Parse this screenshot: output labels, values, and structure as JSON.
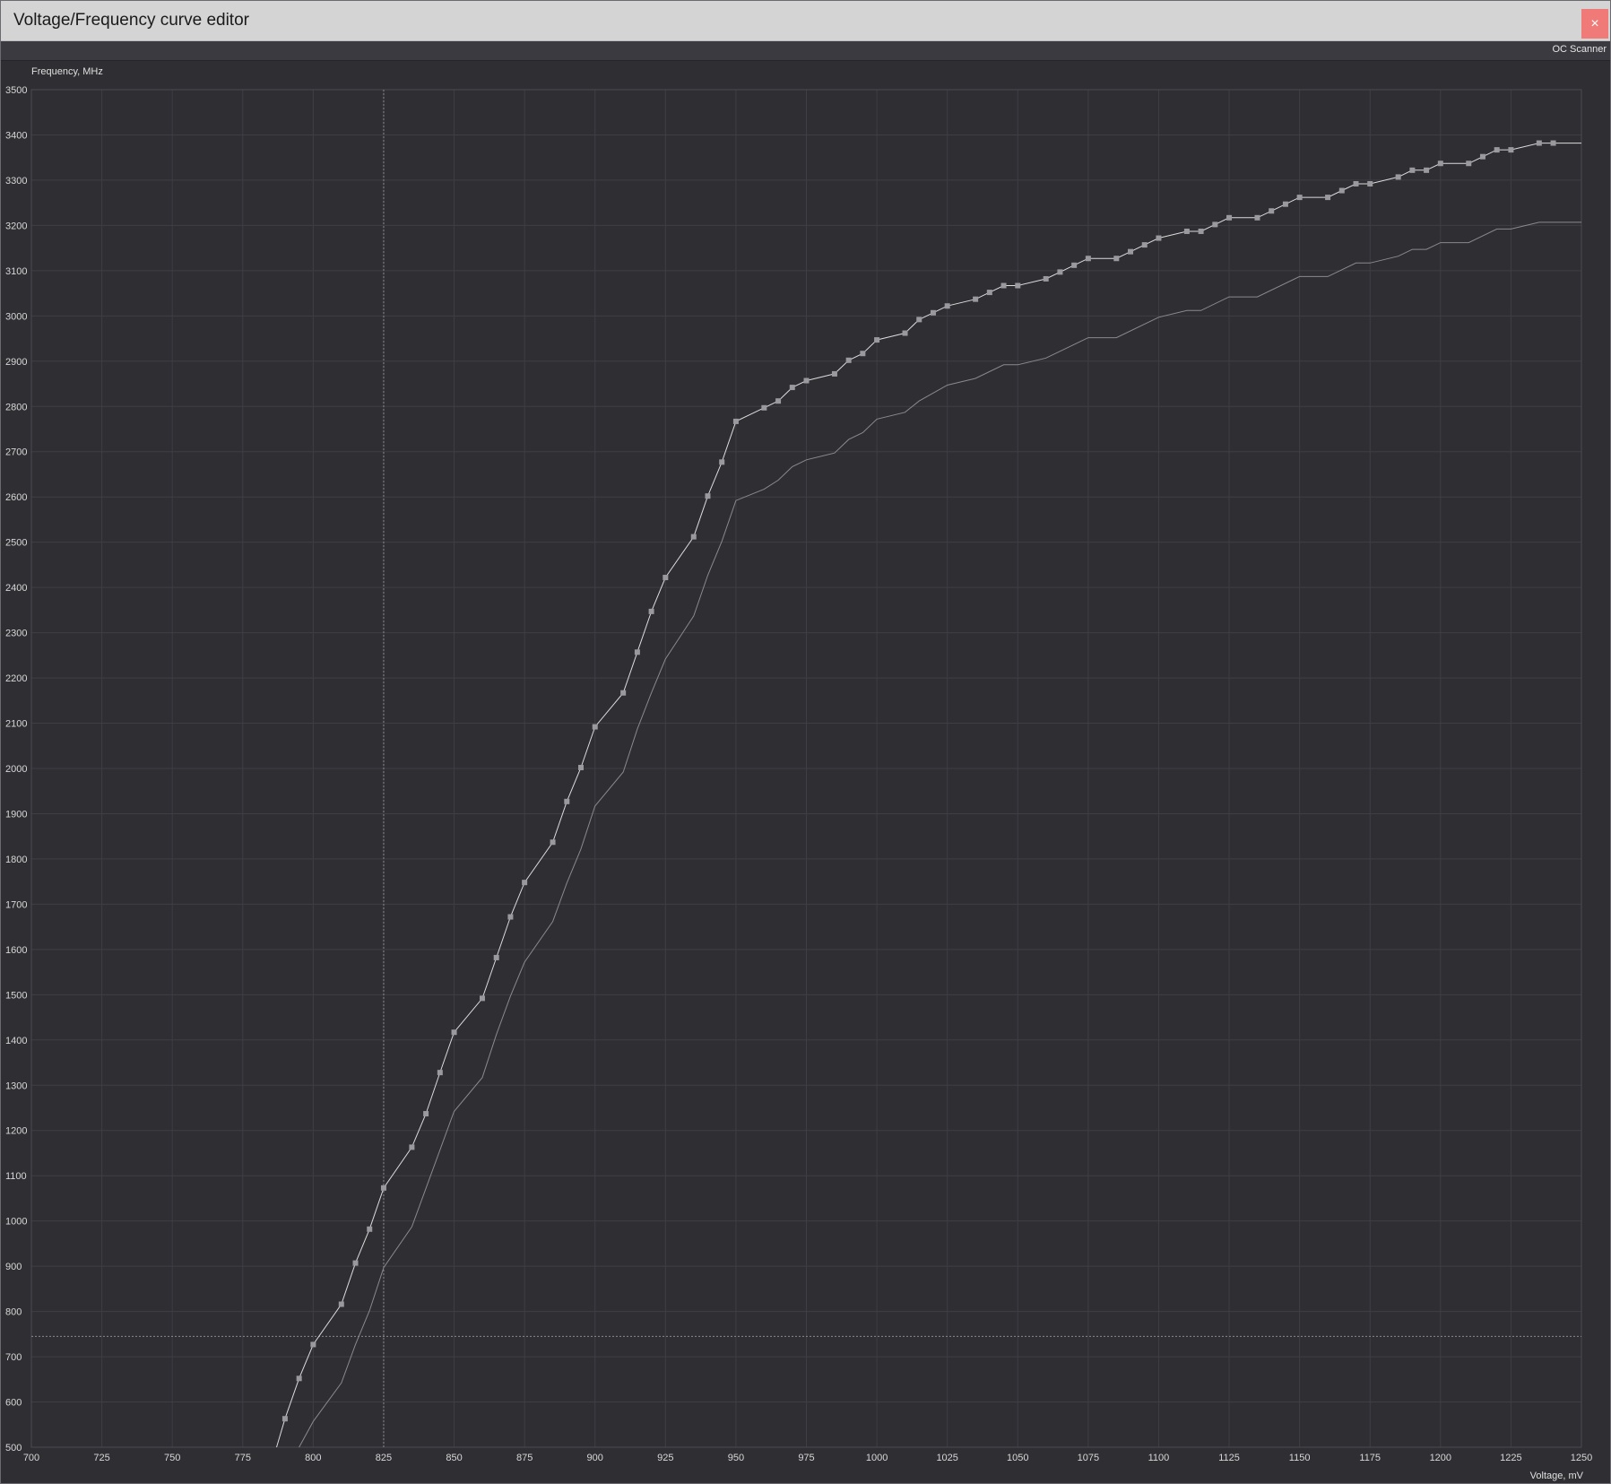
{
  "window": {
    "title": "Voltage/Frequency curve editor",
    "close_label": "×"
  },
  "toolbar": {
    "oc_scanner_label": "OC Scanner"
  },
  "colors": {
    "background": "#2e2e33",
    "grid": "#3e3e44",
    "curve": "#dcdcdc",
    "baseline_curve": "#8a8a8e",
    "point": "#9a9a9e",
    "close_button": "#f07a78"
  },
  "chart_data": {
    "type": "line",
    "xlabel": "Voltage, mV",
    "ylabel": "Frequency, MHz",
    "xlim": [
      700,
      1250
    ],
    "ylim": [
      500,
      3500
    ],
    "x_ticks": [
      700,
      725,
      750,
      775,
      800,
      825,
      850,
      875,
      900,
      925,
      950,
      975,
      1000,
      1025,
      1050,
      1075,
      1100,
      1125,
      1150,
      1175,
      1200,
      1225,
      1250
    ],
    "y_ticks": [
      500,
      600,
      700,
      800,
      900,
      1000,
      1100,
      1200,
      1300,
      1400,
      1500,
      1600,
      1700,
      1800,
      1900,
      2000,
      2100,
      2200,
      2300,
      2400,
      2500,
      2600,
      2700,
      2800,
      2900,
      3000,
      3100,
      3200,
      3300,
      3400,
      3500
    ],
    "grid": true,
    "cursor": {
      "voltage": 825,
      "frequency": 745
    },
    "series": [
      {
        "role": "edited",
        "points": [
          [
            787,
            500
          ],
          [
            790,
            563
          ],
          [
            795,
            652
          ],
          [
            800,
            727
          ],
          [
            810,
            816
          ],
          [
            815,
            907
          ],
          [
            820,
            982
          ],
          [
            825,
            1073
          ],
          [
            835,
            1163
          ],
          [
            840,
            1237
          ],
          [
            845,
            1328
          ],
          [
            850,
            1417
          ],
          [
            860,
            1492
          ],
          [
            865,
            1582
          ],
          [
            870,
            1672
          ],
          [
            875,
            1748
          ],
          [
            885,
            1837
          ],
          [
            890,
            1927
          ],
          [
            895,
            2002
          ],
          [
            900,
            2092
          ],
          [
            910,
            2167
          ],
          [
            915,
            2257
          ],
          [
            920,
            2347
          ],
          [
            925,
            2422
          ],
          [
            935,
            2512
          ],
          [
            940,
            2602
          ],
          [
            945,
            2677
          ],
          [
            950,
            2767
          ],
          [
            960,
            2797
          ],
          [
            965,
            2812
          ],
          [
            970,
            2842
          ],
          [
            975,
            2857
          ],
          [
            985,
            2872
          ],
          [
            990,
            2902
          ],
          [
            995,
            2917
          ],
          [
            1000,
            2947
          ],
          [
            1010,
            2962
          ],
          [
            1015,
            2992
          ],
          [
            1020,
            3007
          ],
          [
            1025,
            3022
          ],
          [
            1035,
            3037
          ],
          [
            1040,
            3052
          ],
          [
            1045,
            3067
          ],
          [
            1050,
            3067
          ],
          [
            1060,
            3082
          ],
          [
            1065,
            3097
          ],
          [
            1070,
            3112
          ],
          [
            1075,
            3127
          ],
          [
            1085,
            3127
          ],
          [
            1090,
            3142
          ],
          [
            1095,
            3157
          ],
          [
            1100,
            3172
          ],
          [
            1110,
            3187
          ],
          [
            1115,
            3187
          ],
          [
            1120,
            3202
          ],
          [
            1125,
            3217
          ],
          [
            1135,
            3217
          ],
          [
            1140,
            3232
          ],
          [
            1145,
            3247
          ],
          [
            1150,
            3262
          ],
          [
            1160,
            3262
          ],
          [
            1165,
            3277
          ],
          [
            1170,
            3292
          ],
          [
            1175,
            3292
          ],
          [
            1185,
            3307
          ],
          [
            1190,
            3322
          ],
          [
            1195,
            3322
          ],
          [
            1200,
            3337
          ],
          [
            1210,
            3337
          ],
          [
            1215,
            3352
          ],
          [
            1220,
            3367
          ],
          [
            1225,
            3367
          ],
          [
            1235,
            3382
          ],
          [
            1240,
            3382
          ],
          [
            1250,
            3382
          ]
        ]
      },
      {
        "role": "baseline",
        "points": [
          [
            795,
            500
          ],
          [
            800,
            557
          ],
          [
            810,
            642
          ],
          [
            815,
            727
          ],
          [
            820,
            802
          ],
          [
            825,
            897
          ],
          [
            835,
            987
          ],
          [
            840,
            1072
          ],
          [
            845,
            1157
          ],
          [
            850,
            1242
          ],
          [
            860,
            1317
          ],
          [
            865,
            1412
          ],
          [
            870,
            1497
          ],
          [
            875,
            1572
          ],
          [
            885,
            1662
          ],
          [
            890,
            1747
          ],
          [
            895,
            1822
          ],
          [
            900,
            1917
          ],
          [
            910,
            1992
          ],
          [
            915,
            2087
          ],
          [
            920,
            2167
          ],
          [
            925,
            2242
          ],
          [
            935,
            2337
          ],
          [
            940,
            2427
          ],
          [
            945,
            2502
          ],
          [
            950,
            2592
          ],
          [
            960,
            2617
          ],
          [
            965,
            2637
          ],
          [
            970,
            2667
          ],
          [
            975,
            2682
          ],
          [
            985,
            2697
          ],
          [
            990,
            2727
          ],
          [
            995,
            2742
          ],
          [
            1000,
            2772
          ],
          [
            1010,
            2787
          ],
          [
            1015,
            2812
          ],
          [
            1025,
            2847
          ],
          [
            1035,
            2862
          ],
          [
            1045,
            2892
          ],
          [
            1050,
            2892
          ],
          [
            1060,
            2907
          ],
          [
            1075,
            2952
          ],
          [
            1085,
            2952
          ],
          [
            1100,
            2997
          ],
          [
            1110,
            3012
          ],
          [
            1115,
            3012
          ],
          [
            1125,
            3042
          ],
          [
            1135,
            3042
          ],
          [
            1150,
            3087
          ],
          [
            1160,
            3087
          ],
          [
            1170,
            3117
          ],
          [
            1175,
            3117
          ],
          [
            1185,
            3132
          ],
          [
            1190,
            3147
          ],
          [
            1195,
            3147
          ],
          [
            1200,
            3162
          ],
          [
            1210,
            3162
          ],
          [
            1220,
            3192
          ],
          [
            1225,
            3192
          ],
          [
            1235,
            3207
          ],
          [
            1250,
            3207
          ]
        ]
      }
    ]
  }
}
